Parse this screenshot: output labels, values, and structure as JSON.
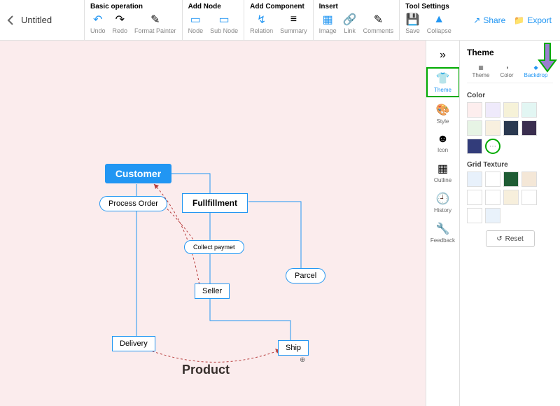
{
  "title": "Untitled",
  "toolbar": {
    "groups": {
      "basic": {
        "title": "Basic operation",
        "undo": "Undo",
        "redo": "Redo",
        "fmt": "Format Painter"
      },
      "addnode": {
        "title": "Add Node",
        "node": "Node",
        "subnode": "Sub Node"
      },
      "addcomp": {
        "title": "Add Component",
        "relation": "Relation",
        "summary": "Summary"
      },
      "insert": {
        "title": "Insert",
        "image": "Image",
        "link": "Link",
        "comments": "Comments"
      },
      "toolset": {
        "title": "Tool Settings",
        "save": "Save",
        "collapse": "Collapse"
      }
    },
    "share": "Share",
    "export": "Export"
  },
  "sidebar": {
    "theme": "Theme",
    "style": "Style",
    "icon": "Icon",
    "outline": "Outline",
    "history": "History",
    "feedback": "Feedback"
  },
  "panel": {
    "title": "Theme",
    "tabs": {
      "theme": "Theme",
      "color": "Color",
      "backdrop": "Backdrop"
    },
    "color_section": "Color",
    "texture_section": "Grid Texture",
    "reset": "Reset",
    "colors_row1": [
      "#fdeeee",
      "#efeafb",
      "#f6f2d8",
      "#e2f6f3",
      "#e7f4e5"
    ],
    "colors_row2": [
      "#f8f0df",
      "#2a3950",
      "#3a2e4f",
      "#323c7a"
    ],
    "textures": [
      "#e8f1fb",
      "#ffffff",
      "#1f5c34",
      "#f4e7d7",
      "#fff",
      "#fff",
      "#f7efdc",
      "#fff",
      "#fff",
      "#e9f2fb"
    ]
  },
  "diagram": {
    "customer": "Customer",
    "process_order": "Process Order",
    "fulfillment": "Fullfillment",
    "collect_payment": "Collect paymet",
    "seller": "Seller",
    "parcel": "Parcel",
    "delivery": "Delivery",
    "ship": "Ship",
    "product": "Product"
  }
}
